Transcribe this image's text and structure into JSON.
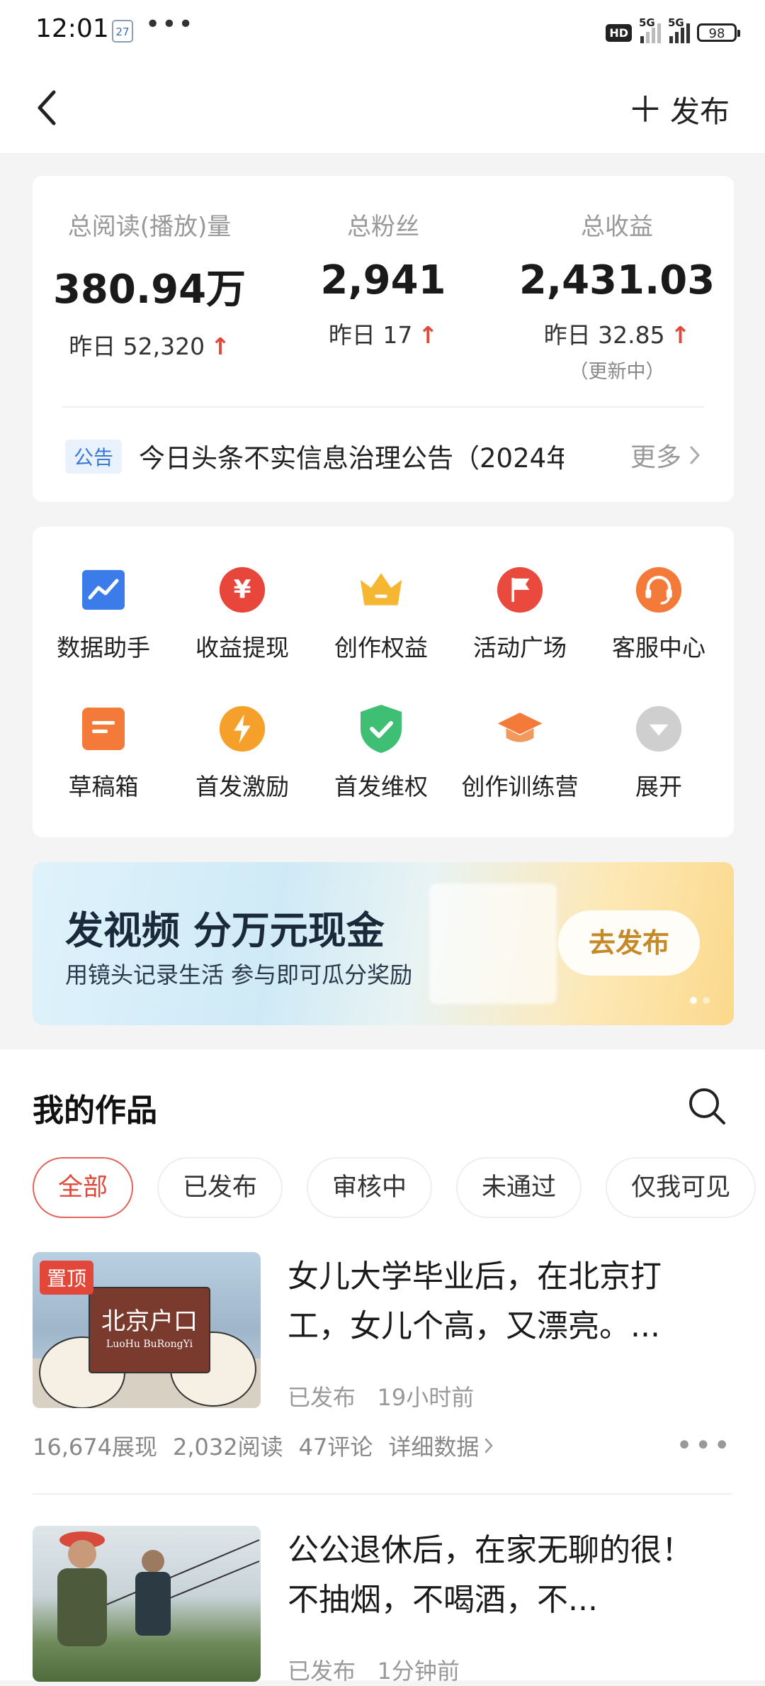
{
  "status_bar": {
    "time": "12:01",
    "calendar_day": "27",
    "more": "•••",
    "hd": "HD",
    "signal1": "5G",
    "signal2": "5G",
    "battery": "98"
  },
  "nav": {
    "back_icon": "chevron-left-icon",
    "publish_icon": "plus-icon",
    "publish_label": "发布"
  },
  "stats": [
    {
      "label": "总阅读(播放)量",
      "value": "380.94万",
      "yesterday": "昨日 52,320",
      "trend": "up"
    },
    {
      "label": "总粉丝",
      "value": "2,941",
      "yesterday": "昨日 17",
      "trend": "up"
    },
    {
      "label": "总收益",
      "value": "2,431.03",
      "yesterday": "昨日 32.85",
      "trend": "up",
      "note": "（更新中）"
    }
  ],
  "notice": {
    "tag": "公告",
    "text": "今日头条不实信息治理公告（2024年...",
    "more": "更多"
  },
  "tools": [
    {
      "label": "数据助手",
      "icon": "chart-icon",
      "color": "#3b7bea"
    },
    {
      "label": "收益提现",
      "icon": "yuan-icon",
      "color": "#e8463a"
    },
    {
      "label": "创作权益",
      "icon": "crown-icon",
      "color": "#f5b731"
    },
    {
      "label": "活动广场",
      "icon": "flag-icon",
      "color": "#ea4a3e"
    },
    {
      "label": "客服中心",
      "icon": "headset-icon",
      "color": "#f47a3a"
    },
    {
      "label": "草稿箱",
      "icon": "draft-icon",
      "color": "#f47a3a"
    },
    {
      "label": "首发激励",
      "icon": "lightning-icon",
      "color": "#f5a02a"
    },
    {
      "label": "首发维权",
      "icon": "shield-check-icon",
      "color": "#3fbf74"
    },
    {
      "label": "创作训练营",
      "icon": "graduation-cap-icon",
      "color": "#f47a3a"
    },
    {
      "label": "展开",
      "icon": "expand-icon",
      "color": "#c9c9c9"
    }
  ],
  "banner": {
    "title": "发视频 分万元现金",
    "subtitle": "用镜头记录生活 参与即可瓜分奖励",
    "button": "去发布"
  },
  "works": {
    "title": "我的作品",
    "tabs": [
      "全部",
      "已发布",
      "审核中",
      "未通过",
      "仅我可见"
    ],
    "active_tab": "全部",
    "articles": [
      {
        "pin": "置顶",
        "thumb_text": "北京户口",
        "thumb_sub": "LuoHu BuRongYi",
        "title": "女儿大学毕业后，在北京打工，女儿个高，又漂亮。...",
        "status": "已发布",
        "time": "19小时前",
        "impressions": "16,674展现",
        "reads": "2,032阅读",
        "comments": "47评论",
        "details": "详细数据"
      },
      {
        "title": "公公退休后，在家无聊的很！不抽烟，不喝酒，不...",
        "status": "已发布",
        "time": "1分钟前"
      }
    ]
  }
}
